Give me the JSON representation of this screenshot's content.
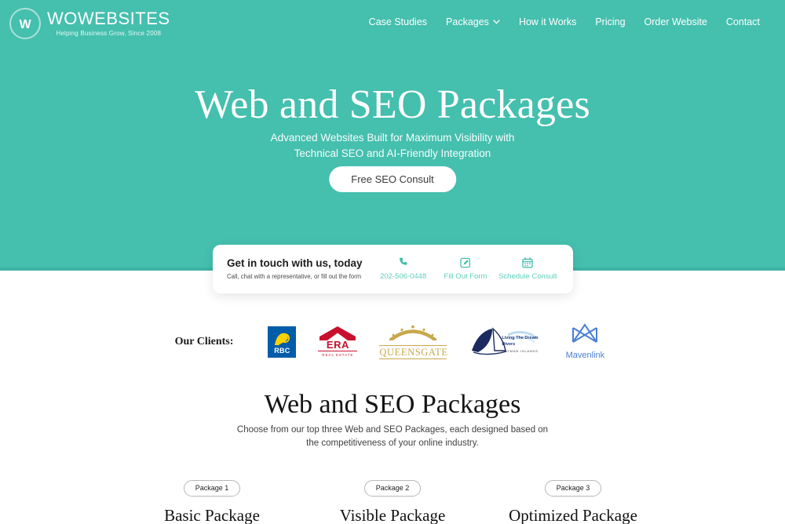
{
  "brand": {
    "mark_icon": "w-circle-logo-icon",
    "name": "WOWEBSITES",
    "tagline": "Helping Business Grow, Since 2008"
  },
  "nav": {
    "items": [
      {
        "label": "Case Studies",
        "has_dropdown": false
      },
      {
        "label": "Packages",
        "has_dropdown": true
      },
      {
        "label": "How it Works",
        "has_dropdown": false
      },
      {
        "label": "Pricing",
        "has_dropdown": false
      },
      {
        "label": "Order Website",
        "has_dropdown": false
      },
      {
        "label": "Contact",
        "has_dropdown": false
      }
    ]
  },
  "hero": {
    "title": "Web and SEO Packages",
    "subtitle_line1": "Advanced Websites Built for Maximum Visibility with",
    "subtitle_line2": "Technical SEO and AI-Friendly Integration",
    "cta_label": "Free SEO Consult",
    "background_color": "#45bfae"
  },
  "contact_card": {
    "title": "Get in touch with us, today",
    "description": "Call, chat with a representative, or fill out the form",
    "actions": [
      {
        "icon": "phone-icon",
        "label": "202-506-0448"
      },
      {
        "icon": "pencil-square-icon",
        "label": "Fill Out Form"
      },
      {
        "icon": "calendar-icon",
        "label": "Schedule Consult"
      }
    ],
    "accent_color": "#5ecfbd"
  },
  "clients": {
    "label": "Our Clients:",
    "logos": [
      {
        "name": "rbc-logo",
        "word": "RBC",
        "dot": "®"
      },
      {
        "name": "era-real-estate-logo",
        "word": "ERA",
        "sub": "REAL ESTATE"
      },
      {
        "name": "queensgate-logo",
        "word": "QUEENSGATE"
      },
      {
        "name": "living-the-dream-divers-logo",
        "line1": "Living The Dream",
        "line2": "Divers",
        "line3": "CAYMAN ISLANDS"
      },
      {
        "name": "mavenlink-logo",
        "word": "Mavenlink"
      }
    ]
  },
  "packages_section": {
    "title": "Web and SEO Packages",
    "subtitle_line1": "Choose from our top three Web and SEO Packages, each designed based on",
    "subtitle_line2": "the competitiveness of your online industry.",
    "cards": [
      {
        "pill": "Package 1",
        "name": "Basic Package"
      },
      {
        "pill": "Package 2",
        "name": "Visible Package"
      },
      {
        "pill": "Package 3",
        "name": "Optimized Package"
      }
    ]
  }
}
